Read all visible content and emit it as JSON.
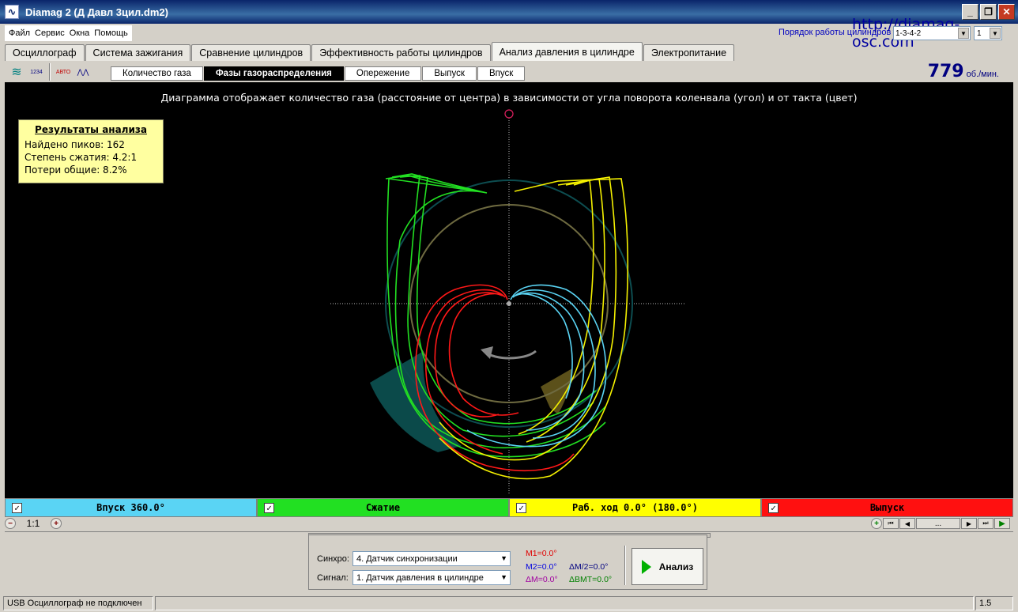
{
  "window": {
    "title": "Diamag 2 (Д Давл 3цил.dm2)",
    "minimize": "_",
    "maximize": "❐",
    "close": "✕"
  },
  "menu": [
    "Файл",
    "Сервис",
    "Окна",
    "Помощь"
  ],
  "watermark": "http://diamag-osc.com",
  "cylinder_order": {
    "label": "Порядок работы цилиндров",
    "value": "1-3-4-2",
    "cylinder": "1"
  },
  "main_tabs": [
    {
      "label": "Осциллограф",
      "active": false
    },
    {
      "label": "Система зажигания",
      "active": false
    },
    {
      "label": "Сравнение цилиндров",
      "active": false
    },
    {
      "label": "Эффективность работы цилиндров",
      "active": false
    },
    {
      "label": "Анализ давления в цилиндре",
      "active": true
    },
    {
      "label": "Электропитание",
      "active": false
    }
  ],
  "toolbar_icons": [
    {
      "name": "sync-wave-icon",
      "glyph": "≋"
    },
    {
      "name": "numbering-icon",
      "glyph": "1234"
    },
    {
      "name": "auto-icon",
      "glyph": "АВТО"
    },
    {
      "name": "peaks-icon",
      "glyph": "⋀⋀"
    }
  ],
  "sub_tabs": [
    {
      "label": "Количество газа",
      "active": false
    },
    {
      "label": "Фазы газораспределения",
      "active": true
    },
    {
      "label": "Опережение",
      "active": false
    },
    {
      "label": "Выпуск",
      "active": false
    },
    {
      "label": "Впуск",
      "active": false
    }
  ],
  "rpm": {
    "value": "779",
    "unit": "об./мин."
  },
  "diagram": {
    "description": "Диаграмма отображает количество газа (расстояние от центра) в зависимости от угла поворота коленвала (угол) и от такта (цвет)",
    "phase_colors": {
      "intake": "#5ad4f4",
      "compression": "#22e022",
      "power": "#f4f000",
      "exhaust": "#ff1010"
    }
  },
  "results": {
    "title": "Результаты анализа",
    "lines": [
      "Найдено пиков: 162",
      "Степень сжатия: 4.2:1",
      "Потери общие: 8.2%"
    ]
  },
  "phases": [
    {
      "label": "Впуск 360.0°",
      "color": "#5ad4f4",
      "checked": "✓"
    },
    {
      "label": "Сжатие",
      "color": "#22e022",
      "checked": "✓"
    },
    {
      "label": "Раб. ход 0.0° (180.0°)",
      "color": "#ffff00",
      "checked": "✓"
    },
    {
      "label": "Выпуск",
      "color": "#ff1010",
      "checked": "✓"
    }
  ],
  "zoom": {
    "label": "1:1",
    "minus": "−",
    "plus": "+"
  },
  "nav": {
    "first": "⏮",
    "prev": "◀",
    "mid": "...",
    "next": "▶",
    "last": "⏭",
    "play": "▶"
  },
  "controls": {
    "sync_label": "Синхро:",
    "sync_value": "4.  Датчик синхронизации",
    "signal_label": "Сигнал:",
    "signal_value": "1.  Датчик давления в цилиндре",
    "m1": "M1=0.0°",
    "m2": "M2=0.0°",
    "dm": "ΔM=0.0°",
    "dm2": "ΔM/2=0.0°",
    "dbmt": "ΔВМТ=0.0°",
    "analyze": "Анализ"
  },
  "status": {
    "left": "USB Осциллограф не подключен",
    "right": "1.5"
  }
}
